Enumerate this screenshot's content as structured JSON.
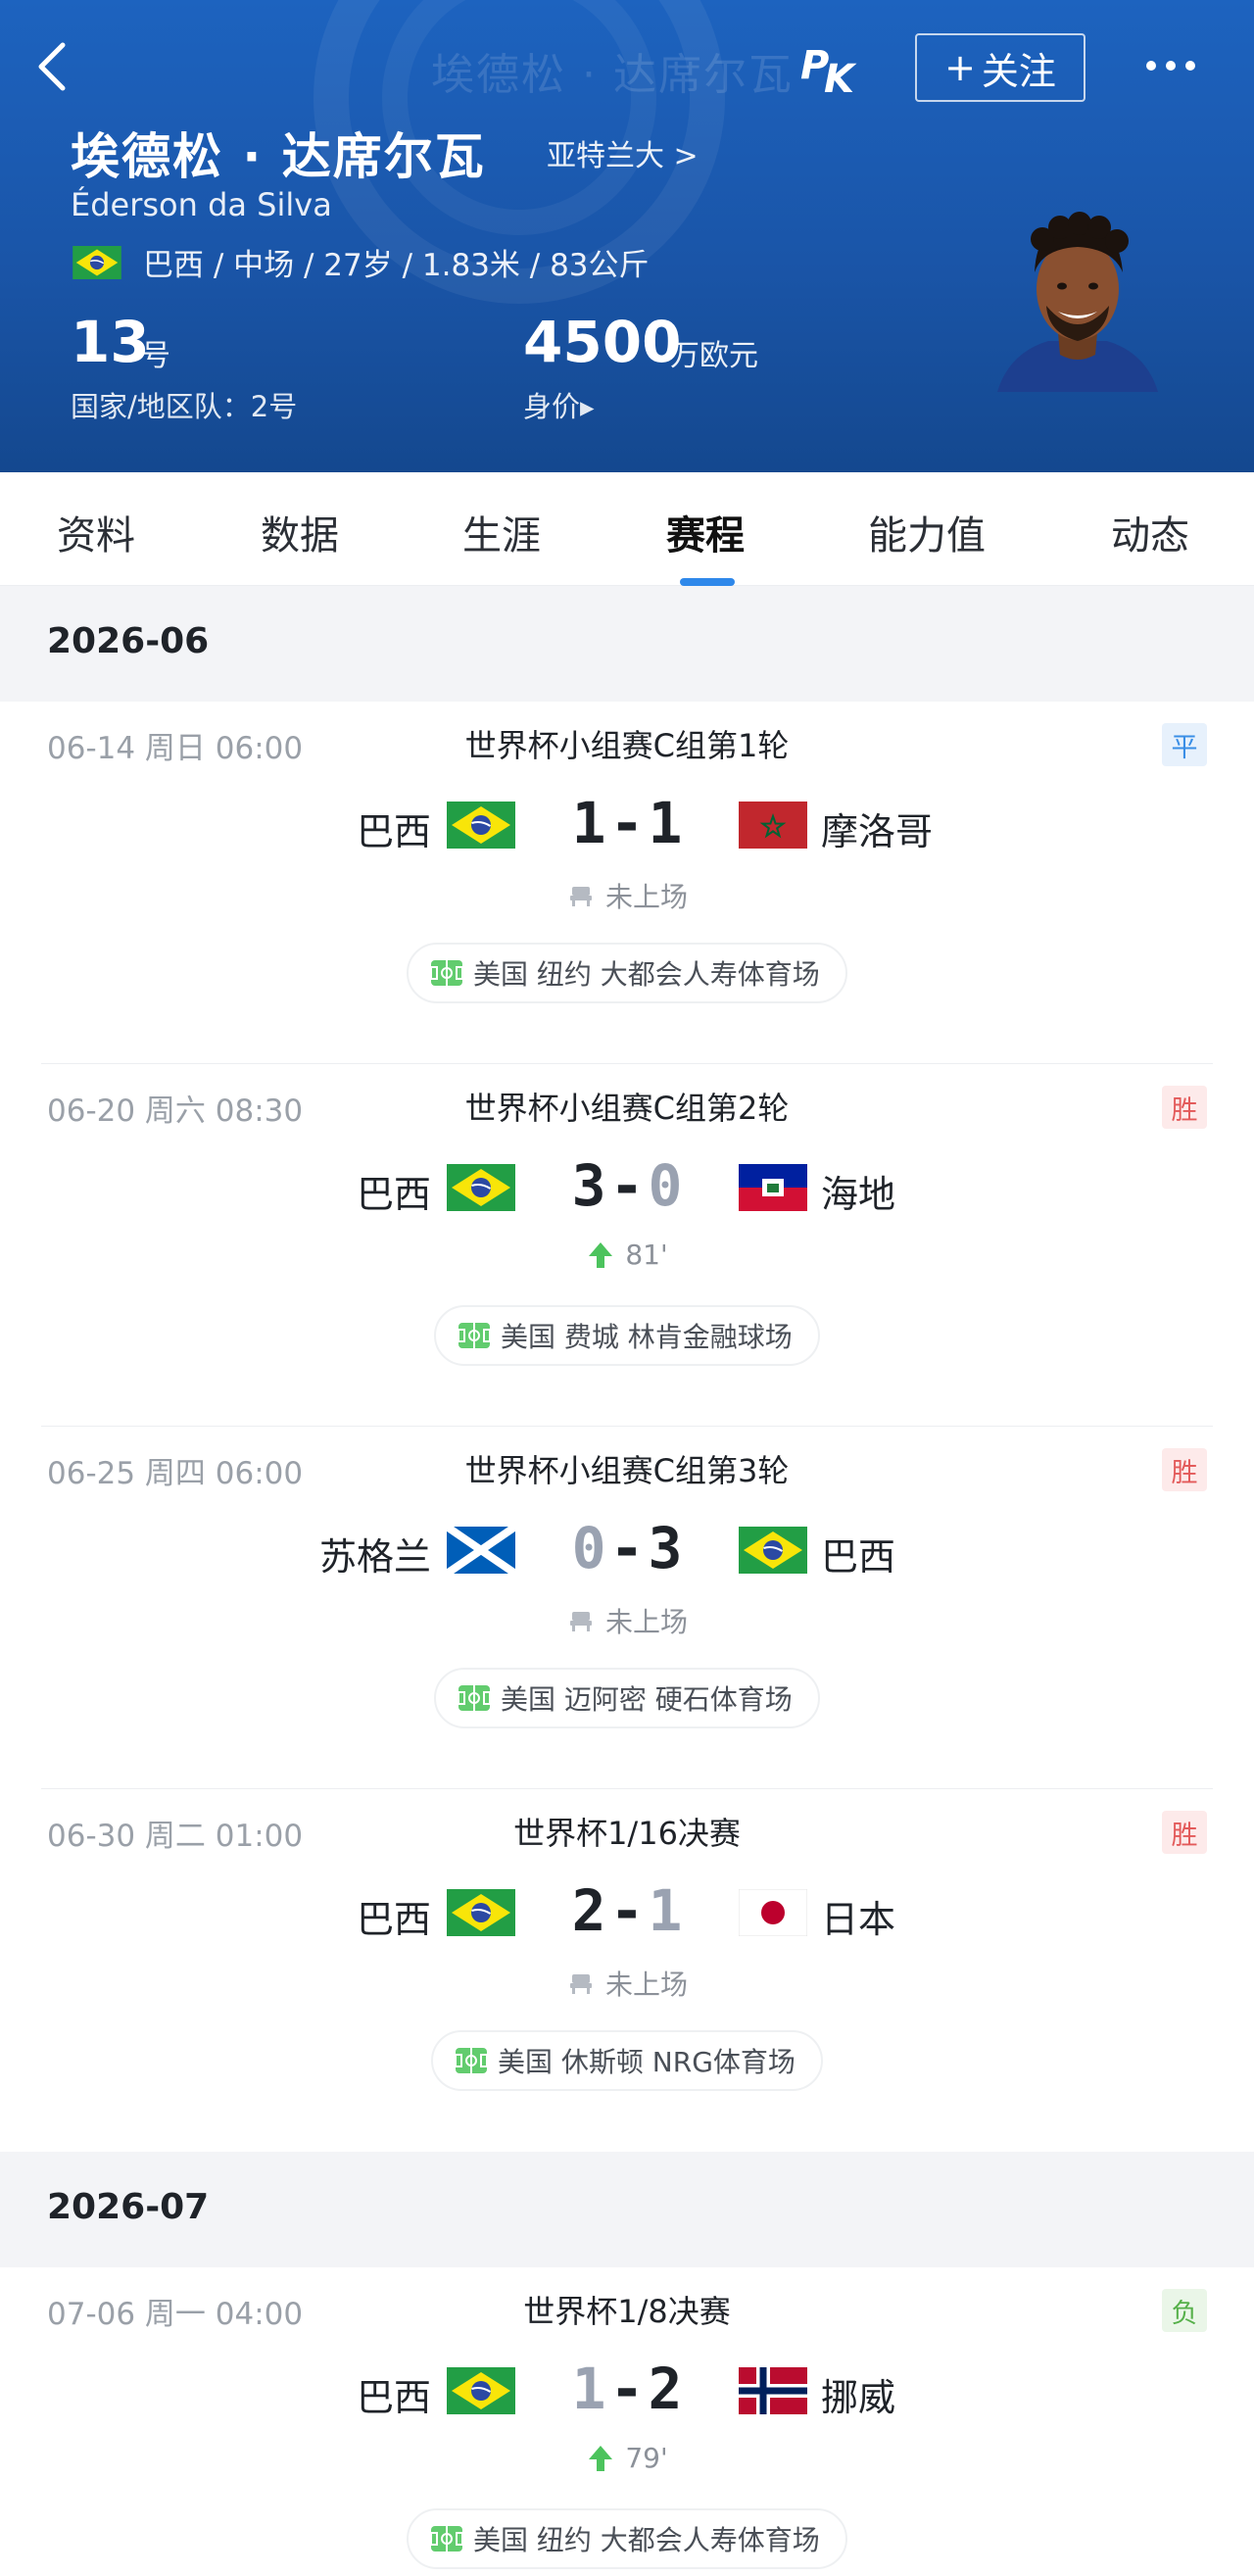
{
  "header": {
    "ghost_title": "埃德松 · 达席尔瓦",
    "player_name": "埃德松 · 达席尔瓦",
    "team_link": "亚特兰大 >",
    "player_name_en": "Éderson da Silva",
    "info": "巴西 / 中场 / 27岁 / 1.83米 / 83公斤",
    "shirt_number": "13",
    "shirt_unit": "号",
    "national_team_number": "国家/地区队：2号",
    "market_value": "4500",
    "market_value_unit": "万欧元",
    "market_value_label": "身价▸",
    "follow_label": "关注",
    "colors": {
      "header_bg": "#1a55a8",
      "accent": "#2e88ea"
    }
  },
  "tabs": [
    {
      "label": "资料"
    },
    {
      "label": "数据"
    },
    {
      "label": "生涯"
    },
    {
      "label": "赛程",
      "active": true
    },
    {
      "label": "能力值"
    },
    {
      "label": "动态"
    }
  ],
  "months": [
    {
      "label": "2026-06",
      "matches": [
        {
          "date": "06-14  周日 06:00",
          "competition": "世界杯小组赛C组第1轮",
          "result": "平",
          "home": "巴西",
          "home_flag": "brazil",
          "home_score": "1",
          "away_score": "1",
          "away": "摩洛哥",
          "away_flag": "morocco",
          "status": "未上场",
          "status_icon": "bench-icon",
          "venue": "美国 纽约 大都会人寿体育场"
        },
        {
          "date": "06-20  周六 08:30",
          "competition": "世界杯小组赛C组第2轮",
          "result": "胜",
          "home": "巴西",
          "home_flag": "brazil",
          "home_score": "3",
          "away_score": "0",
          "away": "海地",
          "away_flag": "haiti",
          "status": "81'",
          "status_icon": "sub-in-arrow-icon",
          "venue": "美国 费城 林肯金融球场"
        },
        {
          "date": "06-25  周四 06:00",
          "competition": "世界杯小组赛C组第3轮",
          "result": "胜",
          "home": "苏格兰",
          "home_flag": "scotland",
          "home_score": "0",
          "away_score": "3",
          "away": "巴西",
          "away_flag": "brazil",
          "status": "未上场",
          "status_icon": "bench-icon",
          "venue": "美国 迈阿密 硬石体育场"
        },
        {
          "date": "06-30  周二 01:00",
          "competition": "世界杯1/16决赛",
          "result": "胜",
          "home": "巴西",
          "home_flag": "brazil",
          "home_score": "2",
          "away_score": "1",
          "away": "日本",
          "away_flag": "japan",
          "status": "未上场",
          "status_icon": "bench-icon",
          "venue": "美国 休斯顿 NRG体育场"
        }
      ]
    },
    {
      "label": "2026-07",
      "matches": [
        {
          "date": "07-06  周一 04:00",
          "competition": "世界杯1/8决赛",
          "result": "负",
          "home": "巴西",
          "home_flag": "brazil",
          "home_score": "1",
          "away_score": "2",
          "away": "挪威",
          "away_flag": "norway",
          "status": "79'",
          "status_icon": "sub-in-arrow-icon",
          "venue": "美国 纽约 大都会人寿体育场"
        }
      ]
    }
  ]
}
